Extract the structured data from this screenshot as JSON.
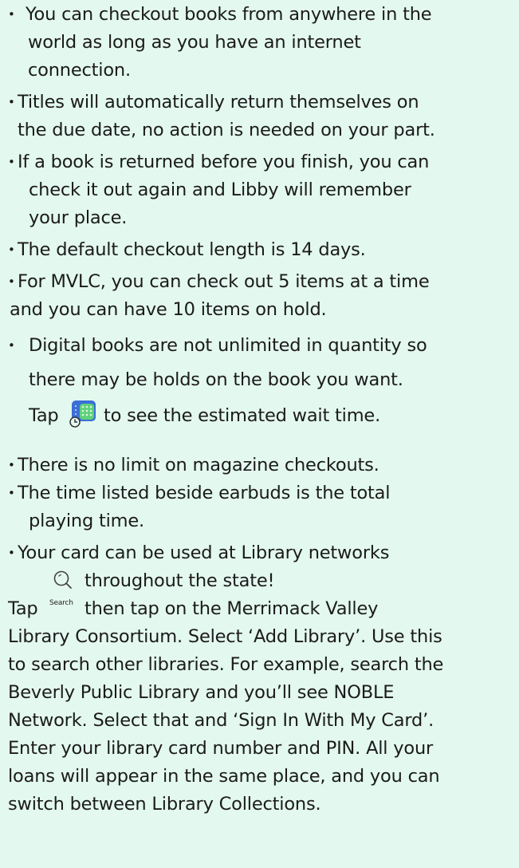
{
  "bullets": [
    {
      "lines": [
        "You can checkout books from anywhere in the",
        "world as long as you have an internet",
        "connection."
      ]
    },
    {
      "lines": [
        "Titles will automatically return themselves on",
        "the due date, no action is needed on your part."
      ]
    },
    {
      "lines": [
        "If a book is returned before you finish, you can",
        "check it out again and Libby will remember",
        "your place."
      ]
    },
    {
      "lines": [
        "The default checkout length is 14 days."
      ]
    },
    {
      "lines": [
        "For MVLC, you can check out 5 items at a time",
        "and you can have 10 items on hold."
      ]
    },
    {
      "lines": [
        "Digital books are not unlimited in quantity so",
        "there may be holds on the book you want."
      ],
      "tap_before": "Tap",
      "tap_after": "to see the estimated wait time."
    },
    {
      "lines": [
        "There is no limit on magazine checkouts."
      ]
    },
    {
      "lines": [
        "The time listed beside earbuds is the total",
        "playing time."
      ]
    },
    {
      "lines": [
        "Your card can be used at Library networks",
        "throughout the state!"
      ]
    }
  ],
  "search_caption": "Search",
  "paragraph": {
    "tap_before": "Tap",
    "first_line_rest": "then tap on the Merrimack Valley",
    "lines": [
      "Library Consortium. Select ‘Add Library’. Use this",
      "to search other libraries. For example, search the",
      "Beverly Public Library and you’ll see NOBLE",
      "Network. Select that and ‘Sign In With My Card’.",
      "Enter your library card number and PIN. All your",
      "loans will appear in the same place, and you can",
      "switch between Library Collections."
    ]
  },
  "colors": {
    "background": "#e3f8ef",
    "text": "#1b1b1b",
    "holds_icon_blue": "#3b6fd6",
    "holds_icon_green": "#5fd17a"
  },
  "icons": {
    "holds": "holds-stack-icon",
    "search": "search-icon"
  }
}
